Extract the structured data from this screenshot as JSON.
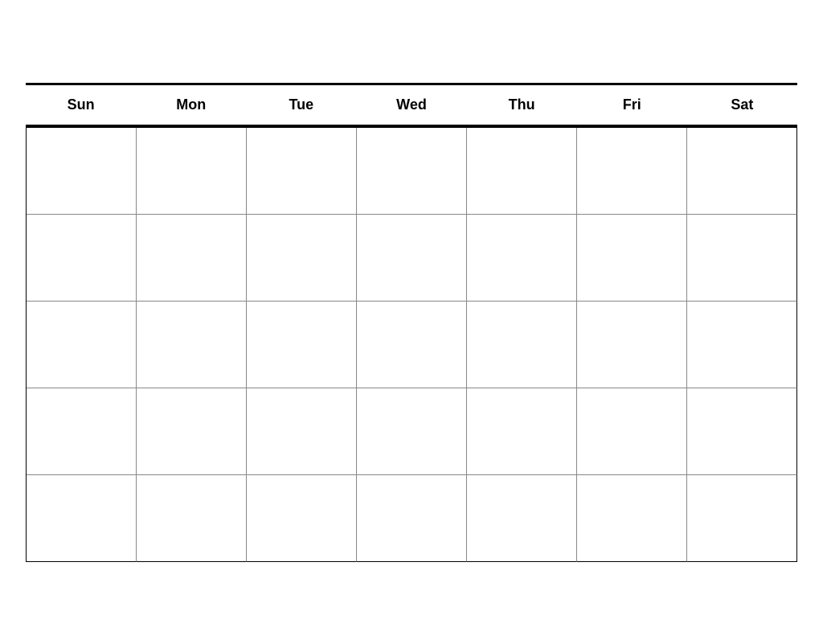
{
  "calendar": {
    "days": [
      {
        "label": "Sun"
      },
      {
        "label": "Mon"
      },
      {
        "label": "Tue"
      },
      {
        "label": "Wed"
      },
      {
        "label": "Thu"
      },
      {
        "label": "Fri"
      },
      {
        "label": "Sat"
      }
    ],
    "rows": 5,
    "cols": 7
  }
}
